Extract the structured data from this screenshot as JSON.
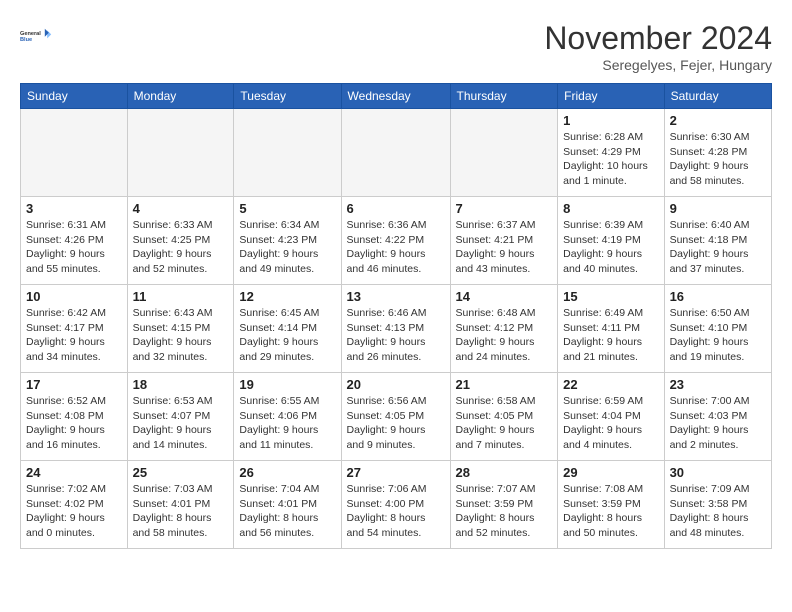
{
  "logo": {
    "line1": "General",
    "line2": "Blue"
  },
  "title": "November 2024",
  "subtitle": "Seregelyes, Fejer, Hungary",
  "days_of_week": [
    "Sunday",
    "Monday",
    "Tuesday",
    "Wednesday",
    "Thursday",
    "Friday",
    "Saturday"
  ],
  "weeks": [
    [
      {
        "day": "",
        "info": ""
      },
      {
        "day": "",
        "info": ""
      },
      {
        "day": "",
        "info": ""
      },
      {
        "day": "",
        "info": ""
      },
      {
        "day": "",
        "info": ""
      },
      {
        "day": "1",
        "info": "Sunrise: 6:28 AM\nSunset: 4:29 PM\nDaylight: 10 hours and 1 minute."
      },
      {
        "day": "2",
        "info": "Sunrise: 6:30 AM\nSunset: 4:28 PM\nDaylight: 9 hours and 58 minutes."
      }
    ],
    [
      {
        "day": "3",
        "info": "Sunrise: 6:31 AM\nSunset: 4:26 PM\nDaylight: 9 hours and 55 minutes."
      },
      {
        "day": "4",
        "info": "Sunrise: 6:33 AM\nSunset: 4:25 PM\nDaylight: 9 hours and 52 minutes."
      },
      {
        "day": "5",
        "info": "Sunrise: 6:34 AM\nSunset: 4:23 PM\nDaylight: 9 hours and 49 minutes."
      },
      {
        "day": "6",
        "info": "Sunrise: 6:36 AM\nSunset: 4:22 PM\nDaylight: 9 hours and 46 minutes."
      },
      {
        "day": "7",
        "info": "Sunrise: 6:37 AM\nSunset: 4:21 PM\nDaylight: 9 hours and 43 minutes."
      },
      {
        "day": "8",
        "info": "Sunrise: 6:39 AM\nSunset: 4:19 PM\nDaylight: 9 hours and 40 minutes."
      },
      {
        "day": "9",
        "info": "Sunrise: 6:40 AM\nSunset: 4:18 PM\nDaylight: 9 hours and 37 minutes."
      }
    ],
    [
      {
        "day": "10",
        "info": "Sunrise: 6:42 AM\nSunset: 4:17 PM\nDaylight: 9 hours and 34 minutes."
      },
      {
        "day": "11",
        "info": "Sunrise: 6:43 AM\nSunset: 4:15 PM\nDaylight: 9 hours and 32 minutes."
      },
      {
        "day": "12",
        "info": "Sunrise: 6:45 AM\nSunset: 4:14 PM\nDaylight: 9 hours and 29 minutes."
      },
      {
        "day": "13",
        "info": "Sunrise: 6:46 AM\nSunset: 4:13 PM\nDaylight: 9 hours and 26 minutes."
      },
      {
        "day": "14",
        "info": "Sunrise: 6:48 AM\nSunset: 4:12 PM\nDaylight: 9 hours and 24 minutes."
      },
      {
        "day": "15",
        "info": "Sunrise: 6:49 AM\nSunset: 4:11 PM\nDaylight: 9 hours and 21 minutes."
      },
      {
        "day": "16",
        "info": "Sunrise: 6:50 AM\nSunset: 4:10 PM\nDaylight: 9 hours and 19 minutes."
      }
    ],
    [
      {
        "day": "17",
        "info": "Sunrise: 6:52 AM\nSunset: 4:08 PM\nDaylight: 9 hours and 16 minutes."
      },
      {
        "day": "18",
        "info": "Sunrise: 6:53 AM\nSunset: 4:07 PM\nDaylight: 9 hours and 14 minutes."
      },
      {
        "day": "19",
        "info": "Sunrise: 6:55 AM\nSunset: 4:06 PM\nDaylight: 9 hours and 11 minutes."
      },
      {
        "day": "20",
        "info": "Sunrise: 6:56 AM\nSunset: 4:05 PM\nDaylight: 9 hours and 9 minutes."
      },
      {
        "day": "21",
        "info": "Sunrise: 6:58 AM\nSunset: 4:05 PM\nDaylight: 9 hours and 7 minutes."
      },
      {
        "day": "22",
        "info": "Sunrise: 6:59 AM\nSunset: 4:04 PM\nDaylight: 9 hours and 4 minutes."
      },
      {
        "day": "23",
        "info": "Sunrise: 7:00 AM\nSunset: 4:03 PM\nDaylight: 9 hours and 2 minutes."
      }
    ],
    [
      {
        "day": "24",
        "info": "Sunrise: 7:02 AM\nSunset: 4:02 PM\nDaylight: 9 hours and 0 minutes."
      },
      {
        "day": "25",
        "info": "Sunrise: 7:03 AM\nSunset: 4:01 PM\nDaylight: 8 hours and 58 minutes."
      },
      {
        "day": "26",
        "info": "Sunrise: 7:04 AM\nSunset: 4:01 PM\nDaylight: 8 hours and 56 minutes."
      },
      {
        "day": "27",
        "info": "Sunrise: 7:06 AM\nSunset: 4:00 PM\nDaylight: 8 hours and 54 minutes."
      },
      {
        "day": "28",
        "info": "Sunrise: 7:07 AM\nSunset: 3:59 PM\nDaylight: 8 hours and 52 minutes."
      },
      {
        "day": "29",
        "info": "Sunrise: 7:08 AM\nSunset: 3:59 PM\nDaylight: 8 hours and 50 minutes."
      },
      {
        "day": "30",
        "info": "Sunrise: 7:09 AM\nSunset: 3:58 PM\nDaylight: 8 hours and 48 minutes."
      }
    ]
  ]
}
